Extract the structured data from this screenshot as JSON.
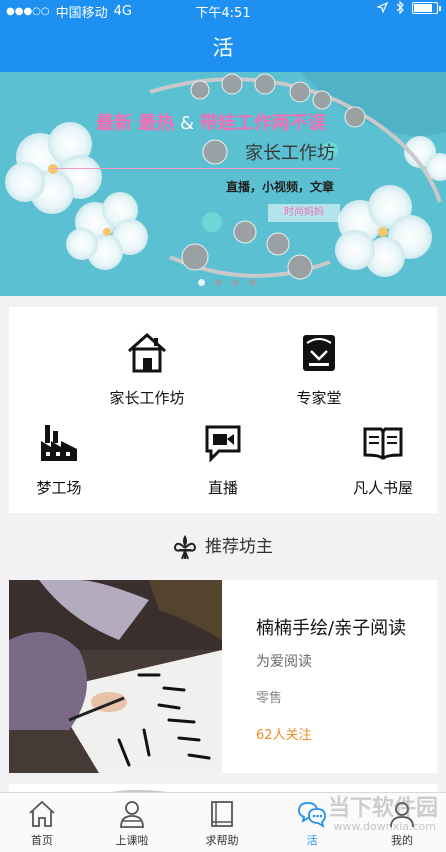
{
  "status_bar": {
    "signal": "●●●○○",
    "carrier": "中国移动",
    "network": "4G",
    "time": "下午4:51"
  },
  "nav": {
    "title": "活"
  },
  "banner": {
    "line1_a": "最新  最热",
    "line1_amp": " & ",
    "line1_b": "带娃工作两不误",
    "line2": "家长工作坊",
    "line3": "直播，小视频，文章",
    "tag": "时尚妈妈",
    "page_count": 4,
    "active_index": 0
  },
  "grid": {
    "items": [
      {
        "label": "家长工作坊",
        "icon": "house-icon"
      },
      {
        "label": "专家堂",
        "icon": "expert-icon"
      },
      {
        "label": "梦工场",
        "icon": "factory-icon"
      },
      {
        "label": "直播",
        "icon": "live-camera-icon"
      },
      {
        "label": "凡人书屋",
        "icon": "book-icon"
      }
    ]
  },
  "section": {
    "title": "推荐坊主",
    "icon": "fleur-de-lis-icon"
  },
  "recommend": {
    "title": "楠楠手绘/亲子阅读",
    "subtitle": "为爱阅读",
    "tag": "零售",
    "follow": "62人关注",
    "follow_color": "#f08a24"
  },
  "tabbar": {
    "tabs": [
      {
        "label": "首页",
        "icon": "home-icon"
      },
      {
        "label": "上课啦",
        "icon": "person-icon"
      },
      {
        "label": "求帮助",
        "icon": "book-help-icon"
      },
      {
        "label": "活",
        "icon": "chat-bubbles-icon"
      },
      {
        "label": "我的",
        "icon": "profile-icon"
      }
    ],
    "active_index": 3
  },
  "watermark": {
    "text": "当下软件园",
    "url": "www.downxia.com"
  },
  "colors": {
    "accent": "#1e90f2",
    "banner": "#5fc2d6",
    "pink": "#f06fb5"
  }
}
